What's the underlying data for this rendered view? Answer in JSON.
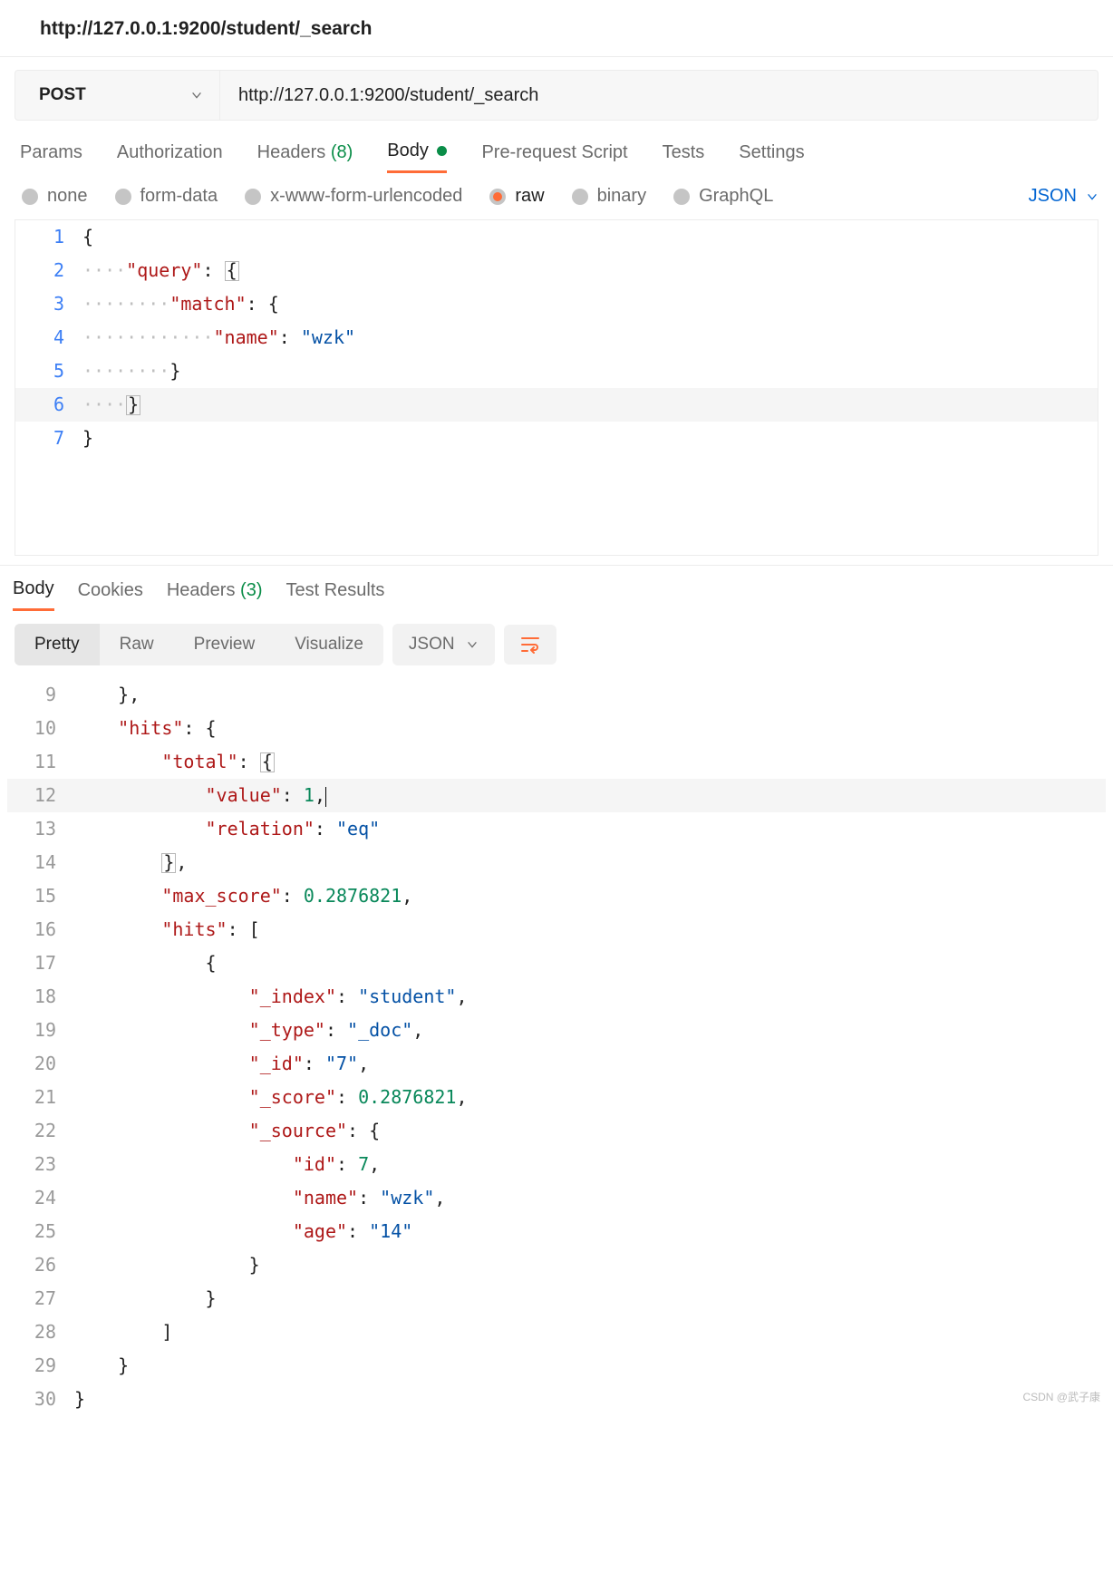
{
  "header": {
    "title": "http://127.0.0.1:9200/student/_search"
  },
  "request": {
    "method": "POST",
    "url": "http://127.0.0.1:9200/student/_search"
  },
  "req_tabs": {
    "params": "Params",
    "auth": "Authorization",
    "headers": "Headers",
    "headers_count": "(8)",
    "body": "Body",
    "prereq": "Pre-request Script",
    "tests": "Tests",
    "settings": "Settings"
  },
  "body_types": {
    "none": "none",
    "formdata": "form-data",
    "xwww": "x-www-form-urlencoded",
    "raw": "raw",
    "binary": "binary",
    "graphql": "GraphQL",
    "lang": "JSON"
  },
  "req_body": {
    "lines": [
      "1",
      "2",
      "3",
      "4",
      "5",
      "6",
      "7"
    ],
    "l1": "{",
    "l2_key": "\"query\"",
    "l3_key": "\"match\"",
    "l4_key": "\"name\"",
    "l4_val": "\"wzk\"",
    "l5": "}",
    "l6": "}",
    "l7": "}"
  },
  "resp_tabs": {
    "body": "Body",
    "cookies": "Cookies",
    "headers": "Headers",
    "headers_count": "(3)",
    "testres": "Test Results"
  },
  "viewbar": {
    "pretty": "Pretty",
    "raw": "Raw",
    "preview": "Preview",
    "visualize": "Visualize",
    "format": "JSON"
  },
  "response": {
    "lines": [
      "9",
      "10",
      "11",
      "12",
      "13",
      "14",
      "15",
      "16",
      "17",
      "18",
      "19",
      "20",
      "21",
      "22",
      "23",
      "24",
      "25",
      "26",
      "27",
      "28",
      "29",
      "30"
    ],
    "k_hits": "\"hits\"",
    "k_total": "\"total\"",
    "k_value": "\"value\"",
    "v_value": "1",
    "k_relation": "\"relation\"",
    "v_relation": "\"eq\"",
    "k_max": "\"max_score\"",
    "v_max": "0.2876821",
    "k_hitsarr": "\"hits\"",
    "k_index": "\"_index\"",
    "v_index": "\"student\"",
    "k_type": "\"_type\"",
    "v_type": "\"_doc\"",
    "k_id": "\"_id\"",
    "v_id": "\"7\"",
    "k_score": "\"_score\"",
    "v_score": "0.2876821",
    "k_source": "\"_source\"",
    "k_sid": "\"id\"",
    "v_sid": "7",
    "k_sname": "\"name\"",
    "v_sname": "\"wzk\"",
    "k_sage": "\"age\"",
    "v_sage": "\"14\"",
    "l9": "},"
  },
  "watermark": "CSDN @武子康"
}
